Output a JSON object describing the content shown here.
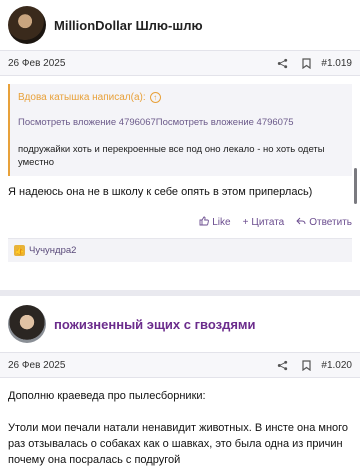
{
  "posts": [
    {
      "username": "MillionDollar Шлю-шлю",
      "date": "26 Фев 2025",
      "number": "#1.019",
      "quote": {
        "author": "Вдова катышка написал(а):",
        "attachments": "Посмотреть вложение 4796067Посмотреть вложение 4796075",
        "text": "подружайки хоть и перекроенные все под оно лекало - но хоть одеты уместно"
      },
      "body": "Я надеюсь она не в школу к себе опять в этом приперлась)",
      "actions": {
        "like": "Like",
        "quote": "Цитата",
        "reply": "Ответить"
      },
      "likes": "Чучундра2"
    },
    {
      "username": "пожизненный эщих с гвоздями",
      "date": "26 Фев 2025",
      "number": "#1.020",
      "body_lines": [
        "Дополню краеведа про пылесборники:",
        "Утоли мои печали натали ненавидит животных. В инсте она много раз отзывалась о собаках как о шавках, это была одна из причин почему она посралась с подругой"
      ]
    }
  ],
  "colors": {
    "accent": "#6b4d8f",
    "quote_border": "#e8a13a",
    "username2": "#6b2c8c"
  }
}
